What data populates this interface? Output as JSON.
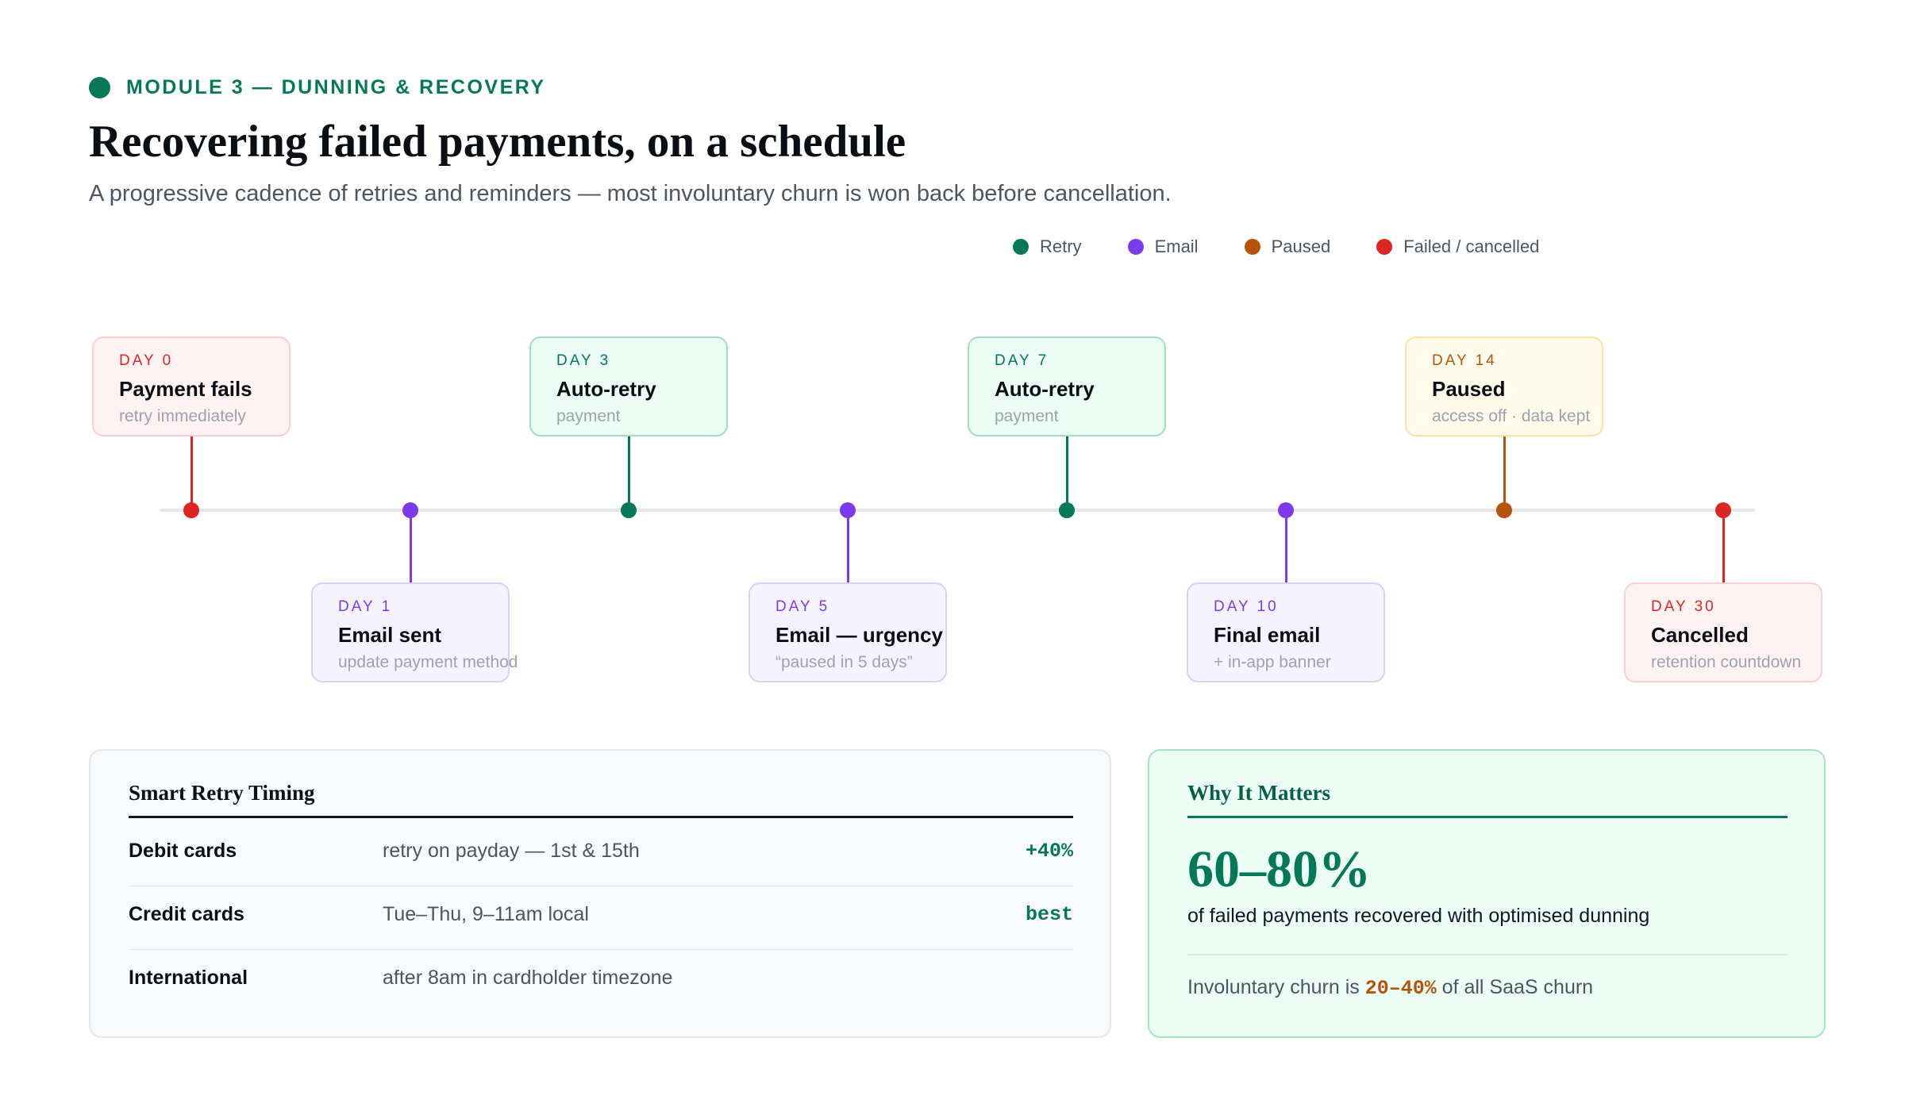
{
  "header": {
    "eyebrow": "MODULE 3 — DUNNING & RECOVERY",
    "title": "Recovering failed payments, on a schedule",
    "subtitle": "A progressive cadence of retries and reminders — most involuntary churn is won back before cancellation."
  },
  "legend": [
    {
      "label": "Retry",
      "color": "#047857"
    },
    {
      "label": "Email",
      "color": "#7c3aed"
    },
    {
      "label": "Paused",
      "color": "#b45309"
    },
    {
      "label": "Failed / cancelled",
      "color": "#dc2626"
    }
  ],
  "timeline": [
    {
      "day": "DAY 0",
      "title": "Payment fails",
      "sub": "retry immediately",
      "kind": "failed"
    },
    {
      "day": "DAY 1",
      "title": "Email sent",
      "sub": "update payment method",
      "kind": "email"
    },
    {
      "day": "DAY 3",
      "title": "Auto-retry",
      "sub": "payment",
      "kind": "retry"
    },
    {
      "day": "DAY 5",
      "title": "Email — urgency",
      "sub": "“paused in 5 days”",
      "kind": "email"
    },
    {
      "day": "DAY 7",
      "title": "Auto-retry",
      "sub": "payment",
      "kind": "retry"
    },
    {
      "day": "DAY 10",
      "title": "Final email",
      "sub": "+ in-app banner",
      "kind": "email"
    },
    {
      "day": "DAY 14",
      "title": "Paused",
      "sub": "access off · data kept",
      "kind": "paused"
    },
    {
      "day": "DAY 30",
      "title": "Cancelled",
      "sub": "retention countdown",
      "kind": "failed"
    }
  ],
  "kinds": {
    "failed": {
      "color": "#dc2626",
      "bg": "#fef2f2",
      "border": "#fbcfcf"
    },
    "email": {
      "color": "#7c3aed",
      "bg": "#f5f3ff",
      "border": "#d9cffb"
    },
    "retry": {
      "color": "#047857",
      "bg": "#ecfdf5",
      "border": "#9fdfc0"
    },
    "paused": {
      "color": "#b45309",
      "bg": "#fffbeb",
      "border": "#f8e2a7"
    }
  },
  "retry_panel": {
    "title": "Smart Retry Timing",
    "rows": [
      {
        "label": "Debit cards",
        "text": "retry on payday — 1st & 15th",
        "tag": "+40%"
      },
      {
        "label": "Credit cards",
        "text": "Tue–Thu, 9–11am local",
        "tag": "best"
      },
      {
        "label": "International",
        "text": "after 8am in cardholder timezone",
        "tag": ""
      }
    ]
  },
  "why_panel": {
    "title": "Why It Matters",
    "stat": "60–80%",
    "stat_desc": "of failed payments recovered with optimised dunning",
    "foot_prefix": "Involuntary churn is ",
    "foot_highlight": "20–40%",
    "foot_suffix": " of all SaaS churn"
  }
}
